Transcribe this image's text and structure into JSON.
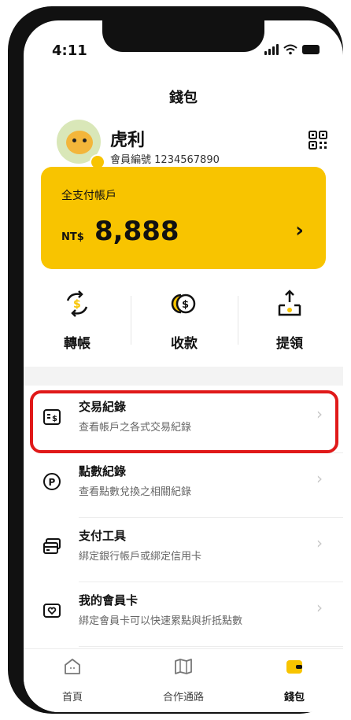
{
  "status_bar": {
    "time": "4:11"
  },
  "header": {
    "title": "錢包"
  },
  "profile": {
    "name": "虎利",
    "member_label": "會員編號",
    "member_number": "1234567890"
  },
  "wallet_card": {
    "label": "全支付帳戶",
    "currency": "NT$",
    "amount": "8,888"
  },
  "actions": [
    {
      "label": "轉帳",
      "icon": "transfer-icon"
    },
    {
      "label": "收款",
      "icon": "receive-money-icon"
    },
    {
      "label": "提領",
      "icon": "withdraw-icon"
    }
  ],
  "menu": [
    {
      "title": "交易紀錄",
      "subtitle": "查看帳戶之各式交易紀錄",
      "icon": "receipt-icon"
    },
    {
      "title": "點數紀錄",
      "subtitle": "查看點數兌換之相關紀錄",
      "icon": "points-icon"
    },
    {
      "title": "支付工具",
      "subtitle": "綁定銀行帳戶或綁定信用卡",
      "icon": "card-icon"
    },
    {
      "title": "我的會員卡",
      "subtitle": "綁定會員卡可以快速累點與折抵點數",
      "icon": "member-card-icon"
    }
  ],
  "tabbar": [
    {
      "label": "首頁",
      "icon": "home-icon"
    },
    {
      "label": "合作通路",
      "icon": "map-icon"
    },
    {
      "label": "錢包",
      "icon": "wallet-icon"
    }
  ],
  "colors": {
    "accent": "#f8c400",
    "highlight": "#e01919"
  }
}
